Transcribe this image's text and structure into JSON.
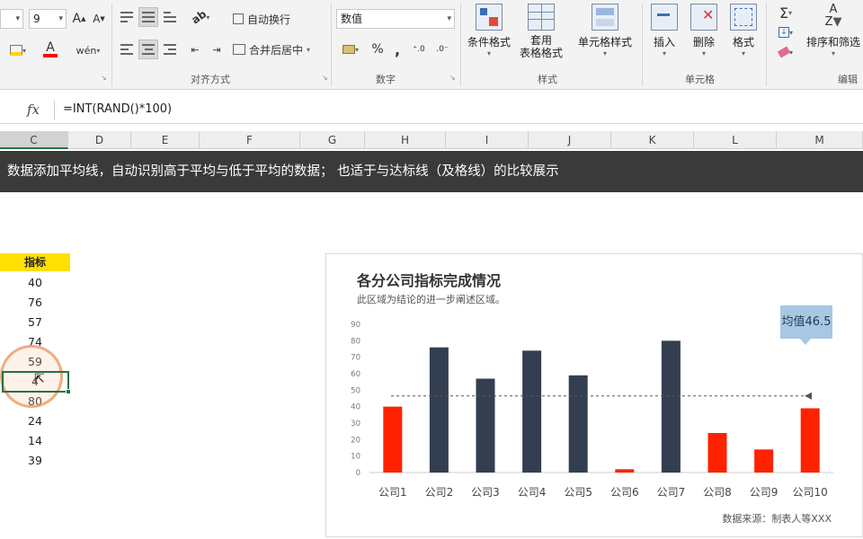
{
  "ribbon": {
    "font_size": "9",
    "grow_font": "A",
    "shrink_font": "A",
    "font_color_letter": "A",
    "wen_glyph": "wén",
    "wrap_text": "自动换行",
    "merge_center": "合并后居中",
    "number_format": "数值",
    "percent": "%",
    "comma": ",",
    "groups": {
      "alignment": "对齐方式",
      "number": "数字",
      "styles": "样式",
      "cells": "单元格",
      "editing": "编辑"
    },
    "styles": {
      "conditional": "条件格式",
      "table_line1": "套用",
      "table_line2": "表格格式",
      "cell_style": "单元格样式"
    },
    "cells": {
      "insert": "插入",
      "delete": "删除",
      "format": "格式"
    },
    "editing": {
      "sum_glyph": "Σ",
      "sort_filter": "排序和筛选"
    }
  },
  "formula_bar": {
    "fx": "fx",
    "formula": "=INT(RAND()*100)"
  },
  "columns": [
    "C",
    "D",
    "E",
    "F",
    "G",
    "H",
    "I",
    "J",
    "K",
    "L",
    "M"
  ],
  "banner": "数据添加平均线，自动识别高于平均与低于平均的数据；  也适于与达标线（及格线）的比较展示",
  "sheet": {
    "header": "指标",
    "values": [
      "40",
      "76",
      "57",
      "74",
      "59",
      "4",
      "80",
      "24",
      "14",
      "39"
    ]
  },
  "colors": {
    "below_avg": "#ff2200",
    "above_avg": "#333f50",
    "avg_line": "#555555",
    "callout": "#a7c7e3",
    "header_fill": "#ffe000"
  },
  "chart_data": {
    "type": "bar",
    "title": "各分公司指标完成情况",
    "subtitle": "此区域为结论的进一步阐述区域。",
    "source": "数据来源：制表人等XXX",
    "categories": [
      "公司1",
      "公司2",
      "公司3",
      "公司4",
      "公司5",
      "公司6",
      "公司7",
      "公司8",
      "公司9",
      "公司10"
    ],
    "values": [
      40,
      76,
      57,
      74,
      59,
      2,
      80,
      24,
      14,
      39
    ],
    "average": 46.5,
    "average_label": "均值46.5",
    "ylim": [
      0,
      90
    ],
    "yticks": [
      0,
      10,
      20,
      30,
      40,
      50,
      60,
      70,
      80,
      90
    ],
    "grid": false,
    "xlabel": "",
    "ylabel": ""
  }
}
